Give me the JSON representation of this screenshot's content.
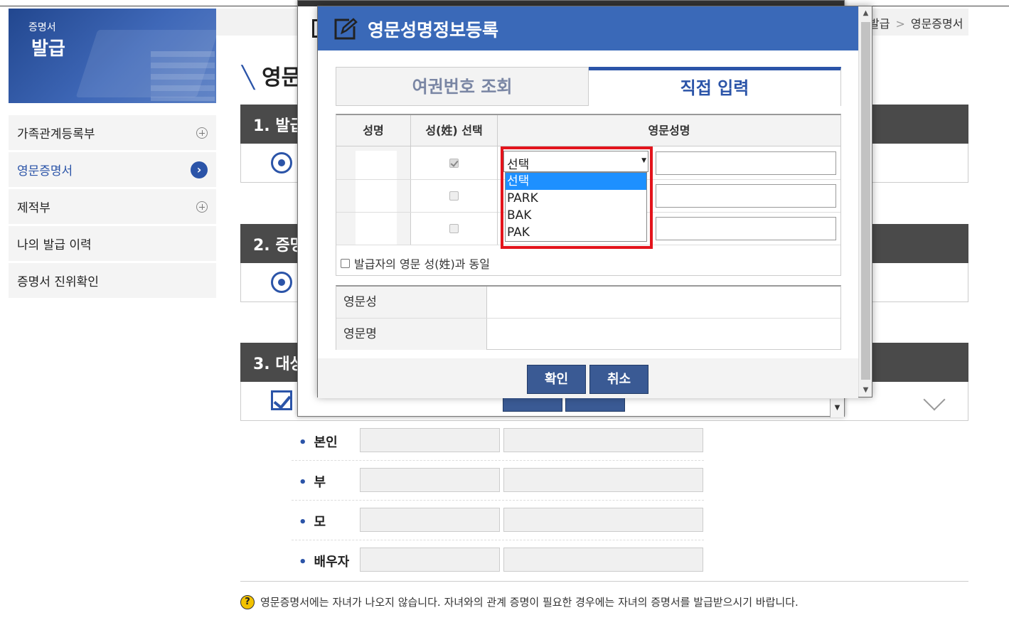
{
  "banner": {
    "small_text": "증명서",
    "big_text": "발급"
  },
  "sidebar": {
    "items": [
      {
        "label": "가족관계등록부",
        "icon": "plus-circle-icon",
        "active": false
      },
      {
        "label": "영문증명서",
        "icon": "arrow-right-icon",
        "active": true
      },
      {
        "label": "제적부",
        "icon": "plus-circle-icon",
        "active": false
      },
      {
        "label": "나의 발급 이력",
        "icon": "",
        "active": false
      },
      {
        "label": "증명서 진위확인",
        "icon": "",
        "active": false
      }
    ]
  },
  "breadcrumb": {
    "parent": "발급",
    "current": "영문증명서",
    "separator": ">"
  },
  "page": {
    "title": "영문",
    "sections": [
      {
        "label": "1. 발급"
      },
      {
        "label": "2. 증명"
      },
      {
        "label": "3. 대상"
      }
    ],
    "family_rows": [
      {
        "label": "본인"
      },
      {
        "label": "부"
      },
      {
        "label": "모"
      },
      {
        "label": "배우자"
      }
    ],
    "notice": "영문증명서에는 자녀가 나오지 않습니다. 자녀와의 관계 증명이 필요한 경우에는 자녀의 증명서를 발급받으시기 바랍니다."
  },
  "modal": {
    "title": "영문성명정보등록",
    "tabs": [
      {
        "label": "여권번호 조회",
        "active": false
      },
      {
        "label": "직접 입력",
        "active": true
      }
    ],
    "table_headers": {
      "name": "성명",
      "surname_select": "성(姓) 선택",
      "english_name": "영문성명"
    },
    "rows": [
      {
        "checked": true
      },
      {
        "checked": false
      },
      {
        "checked": false
      }
    ],
    "same_surname_label": "발급자의 영문 성(姓)과 동일",
    "result": {
      "eng_surname_label": "영문성",
      "eng_given_label": "영문명"
    },
    "buttons": {
      "confirm": "확인",
      "cancel": "취소"
    }
  },
  "dropdown": {
    "selected": "선택",
    "options": [
      "선택",
      "PARK",
      "BAK",
      "PAK"
    ],
    "highlight_color": "#e3141c"
  },
  "colors": {
    "accent": "#2b54a8",
    "modal_header": "#3a69b8",
    "button": "#3a5a94",
    "section_header": "#4a4a4a"
  }
}
